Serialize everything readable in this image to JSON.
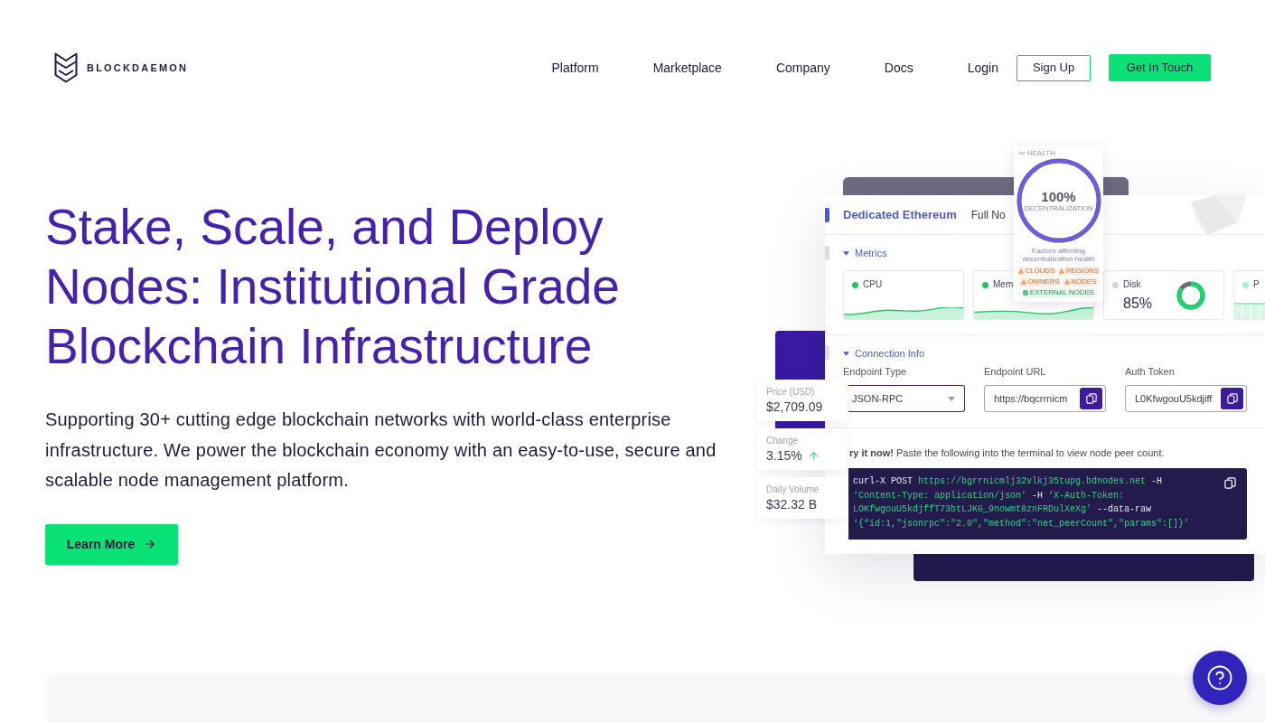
{
  "header": {
    "logo_text": "BLOCKDAEMON",
    "nav": [
      "Platform",
      "Marketplace",
      "Company",
      "Docs",
      "Login"
    ],
    "sign_up": "Sign Up",
    "contact": "Get In Touch"
  },
  "hero": {
    "heading_lines": [
      "Stake, Scale, and Deploy",
      "Nodes: Institutional Grade",
      "Blockchain Infrastructure"
    ],
    "description": "Supporting 30+ cutting edge blockchain networks with world-class enterprise infrastructure. We power the blockchain economy with an easy-to-use, secure and scalable node management platform.",
    "button": "Learn More"
  },
  "dashboard": {
    "stats": [
      {
        "label": "Price (USD)",
        "value": "$2,709.09"
      },
      {
        "label": "Change",
        "value": "3.15%",
        "rising": true
      },
      {
        "label": "Daily Volume",
        "value": "$32.32 B"
      }
    ],
    "node_title": "Dedicated Ethereum",
    "node_type": "Full No",
    "health": {
      "label": "HEALTH",
      "value": "100%",
      "caption": "DECENTRALIZATION",
      "level": 1,
      "factors_text": "Factors affecting decentralization health",
      "factors": [
        {
          "label": "CLOUDS",
          "kind": "warning"
        },
        {
          "label": "REGIONS",
          "kind": "warning"
        },
        {
          "label": "OWNERS",
          "kind": "warning"
        },
        {
          "label": "NODES",
          "kind": "warning"
        },
        {
          "label": "EXTERNAL NODES",
          "kind": "ok"
        }
      ]
    },
    "metrics": {
      "title": "Metrics",
      "expanded": true,
      "cards": [
        {
          "label": "CPU",
          "color": "#22c55e",
          "kind": "sparkline"
        },
        {
          "label": "Mem",
          "color": "#22c55e",
          "kind": "sparkline"
        },
        {
          "label": "Disk",
          "color": "#d1d5db",
          "kind": "gauge",
          "value": "85%",
          "level": 0.85
        },
        {
          "label": "P",
          "color": "#a7f0c8",
          "kind": "bars"
        }
      ]
    },
    "connection": {
      "title": "Connection Info",
      "expanded": true,
      "fields": [
        {
          "label": "Endpoint Type",
          "kind": "select",
          "value": "JSON-RPC",
          "focused": true
        },
        {
          "label": "Endpoint URL",
          "kind": "copy",
          "value": "https://bqcrrnicm",
          "focused": false
        },
        {
          "label": "Auth Token",
          "kind": "copy",
          "value": "L0KfwgouU5kdjiff",
          "focused": false
        }
      ]
    },
    "try_it": "**ry it now!** Paste the following into the terminal to view node peer count.",
    "code_lines": [
      [
        {
          "kind": "command",
          "text": "curl-X POST "
        },
        {
          "kind": "string",
          "text": "https://bgrrnicmlj32vlkj35tupg.bdnodes.net"
        },
        {
          "kind": "command",
          "text": " -H"
        }
      ],
      [
        {
          "kind": "string",
          "text": "‘Content-Type: application/json’"
        },
        {
          "kind": "command",
          "text": " -H "
        },
        {
          "kind": "string",
          "text": "‘X-Auth-Token:"
        }
      ],
      [
        {
          "kind": "string",
          "text": "LOKfwgouU5kdjffT73btLJKG_9nowmt8znFRDulXeXg’"
        },
        {
          "kind": "command",
          "text": " --data-raw"
        }
      ],
      [
        {
          "kind": "string",
          "text": "‘{“id:1,\"jsonrpc\":\"2.0\",\"method\":\"net_peerCount\",\"params\":[]}’"
        }
      ]
    ]
  }
}
